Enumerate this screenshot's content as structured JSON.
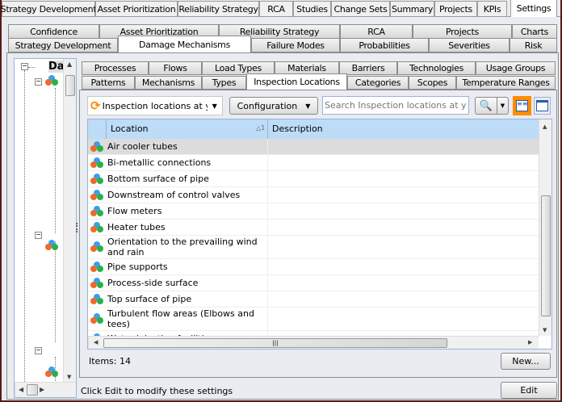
{
  "top_tabs": [
    "Strategy Development",
    "Asset Prioritization",
    "Reliability Strategy",
    "RCA",
    "Studies",
    "Change Sets",
    "Summary",
    "Projects",
    "KPIs",
    "Settings"
  ],
  "settings_tabs_row1": [
    "Confidence",
    "Asset Prioritization",
    "Reliability Strategy",
    "RCA",
    "Projects",
    "Charts"
  ],
  "settings_tabs_row2": [
    "Strategy Development",
    "Damage Mechanisms",
    "Failure Modes",
    "Probabilities",
    "Severities",
    "Risk"
  ],
  "tree": {
    "root_label": "Da"
  },
  "dm_tabs_row1": [
    "Processes",
    "Flows",
    "Load Types",
    "Materials",
    "Barriers",
    "Technologies",
    "Usage Groups"
  ],
  "dm_tabs_row2": [
    "Patterns",
    "Mechanisms",
    "Types",
    "Inspection Locations",
    "Categories",
    "Scopes",
    "Temperature Ranges"
  ],
  "toolbar": {
    "query_value": "Inspection locations at you",
    "configuration_label": "Configuration",
    "search_placeholder": "Search Inspection locations at your e"
  },
  "grid": {
    "columns": [
      "Location",
      "Description"
    ],
    "sort_indicator": "1",
    "rows": [
      "Air cooler tubes",
      "Bi-metallic connections",
      "Bottom surface of pipe",
      "Downstream of control valves",
      "Flow meters",
      "Heater tubes",
      "Orientation to the prevailing wind and rain",
      "Pipe supports",
      "Process-side surface",
      "Top surface of pipe",
      "Turbulent flow areas (Elbows and tees)",
      "Water injection facilities"
    ]
  },
  "footer": {
    "items_count": "Items: 14",
    "new_label": "New..."
  },
  "status": {
    "hint": "Click Edit to modify these settings",
    "edit_label": "Edit"
  },
  "colors": {
    "accent": "#ff8c00",
    "header": "#bcdcf8"
  }
}
